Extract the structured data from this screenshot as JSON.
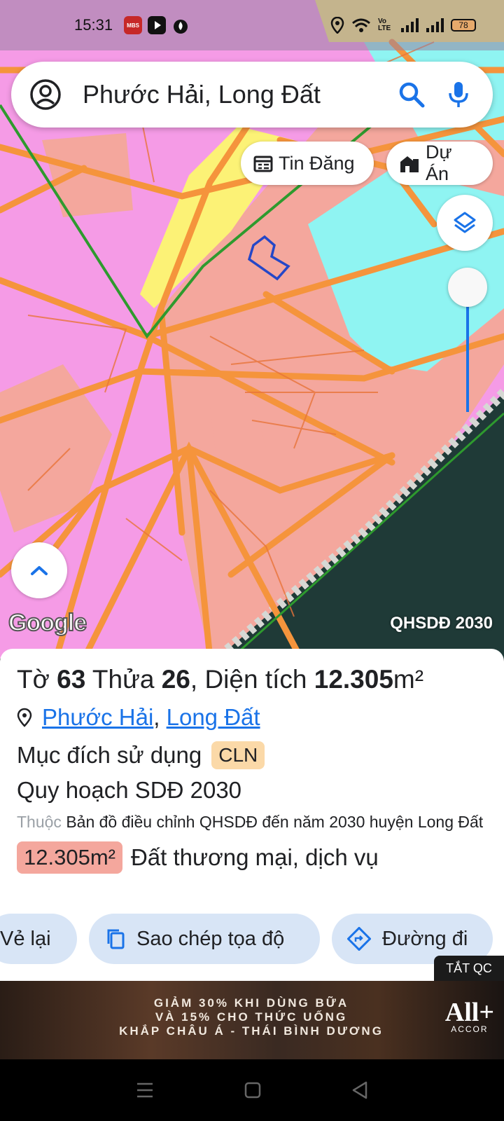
{
  "status_bar": {
    "time": "15:31",
    "apps": [
      "mbs-app-icon",
      "youtube-icon",
      "fire-icon"
    ],
    "mbs_label": "MBS",
    "right_icons": [
      "location-icon",
      "wifi-icon",
      "volte-icon",
      "signal-icon",
      "signal-icon"
    ],
    "volte_label": "Vo LTE",
    "battery": "78"
  },
  "search": {
    "text": "Phước Hải, Long Đất"
  },
  "chips": {
    "tin_dang": "Tin Đăng",
    "du_an": "Dự Án"
  },
  "map": {
    "provider_logo": "Google",
    "layer_label": "QHSDĐ 2030",
    "colors": {
      "residential": "#f59be6",
      "commercial": "#f4a79d",
      "road": "#f5943c",
      "green": "#fcf276",
      "water": "#8ff4f2",
      "sea": "#1f3a37"
    },
    "opacity_slider": {
      "level_fraction": 0.0
    }
  },
  "info": {
    "title_prefix": "Tờ ",
    "sheet_no": "63",
    "title_mid": " Thửa ",
    "plot_no": "26",
    "title_area_label": ", Diện tích ",
    "area_value": "12.305",
    "area_unit": "m²",
    "commune": "Phước Hải",
    "district": "Long Đất",
    "purpose_label": "Mục đích sử dụng",
    "purpose_code": "CLN",
    "plan_label": "Quy hoạch SDĐ 2030",
    "source_muted": "Thuộc",
    "source_text": " Bản đồ điều chỉnh QHSDĐ đến năm 2030 huyện Long Đất",
    "zone_area": "12.305m²",
    "zone_type": "Đất thương mại, dịch vụ"
  },
  "actions": {
    "redraw": "Vẻ lại",
    "copy_coords": "Sao chép tọa độ",
    "directions": "Đường đi"
  },
  "ad": {
    "close_label": "TẮT QC",
    "line1": "GIẢM 30% KHI DÙNG BỮA",
    "line2": "VÀ 15% CHO THỨC UỐNG",
    "line3": "KHẮP CHÂU Á - THÁI BÌNH DƯƠNG",
    "brand": "All+",
    "brand_sub": "ACCOR"
  }
}
